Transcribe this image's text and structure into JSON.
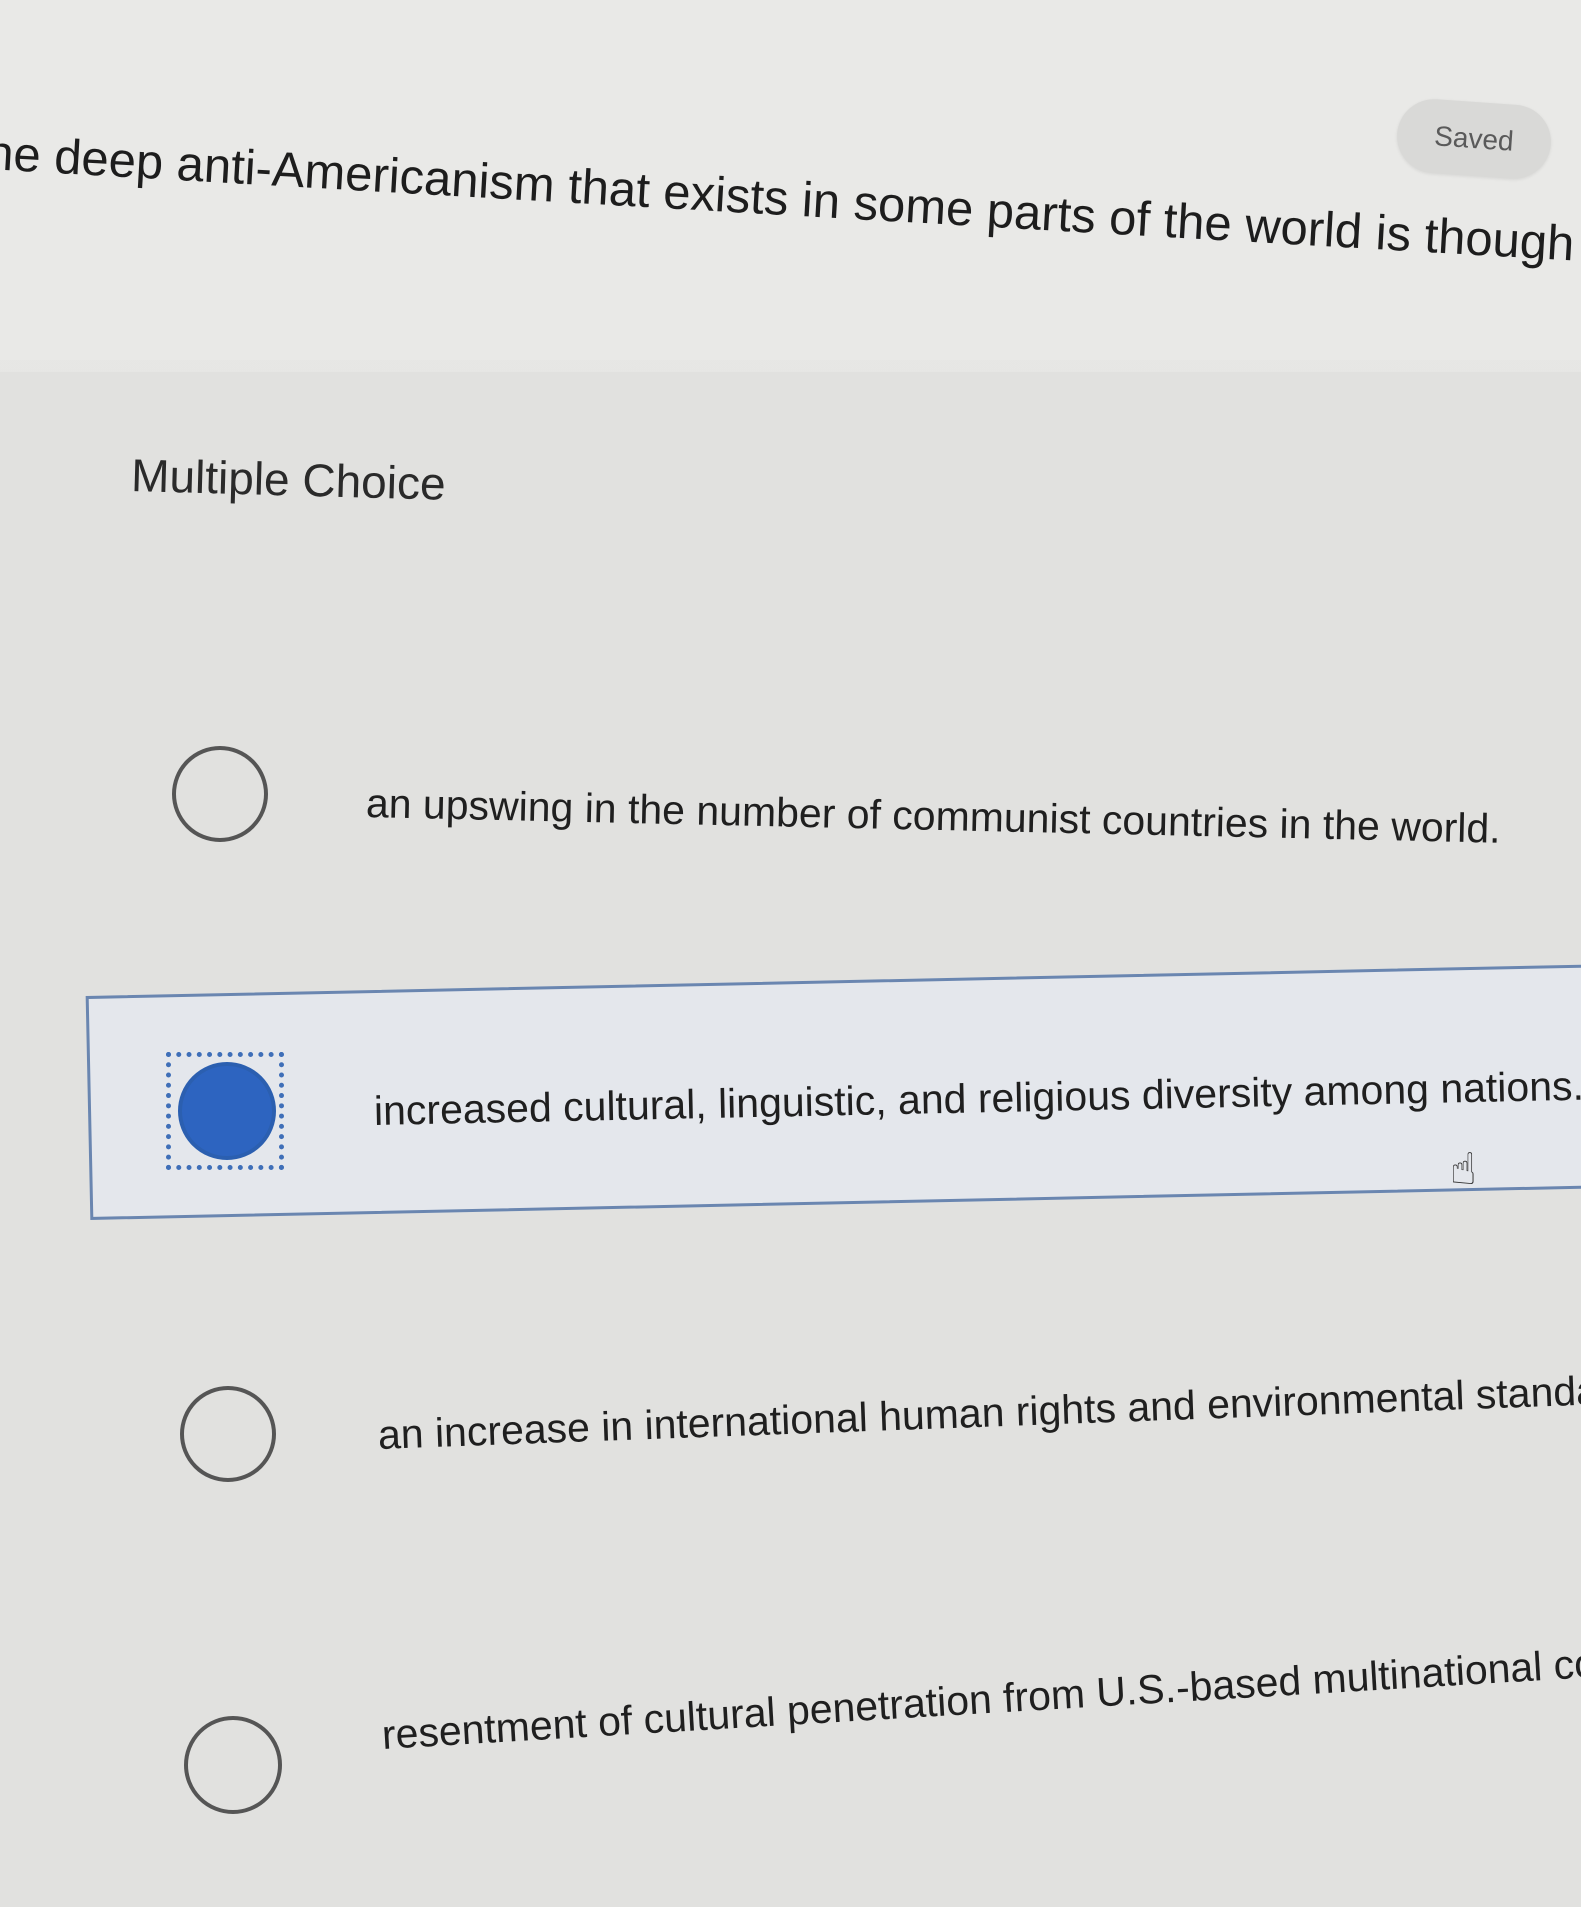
{
  "status": {
    "saved_label": "Saved"
  },
  "question": {
    "text": "he deep anti-Americanism that exists in some parts of the world is thought to be"
  },
  "question_type": "Multiple Choice",
  "options": [
    {
      "label": "an upswing in the number of communist countries in the world.",
      "selected": false
    },
    {
      "label": "increased cultural, linguistic, and religious diversity among nations.",
      "selected": true
    },
    {
      "label": "an increase in international human rights and environmental standards.",
      "selected": false
    },
    {
      "label": "resentment of cultural penetration from U.S.-based multinational corpora",
      "selected": false
    }
  ],
  "colors": {
    "accent": "#2d64c0",
    "selected_border": "#6a86b0",
    "text": "#1f1f1f"
  },
  "icons": {
    "cursor": "hand-pointer-icon"
  }
}
